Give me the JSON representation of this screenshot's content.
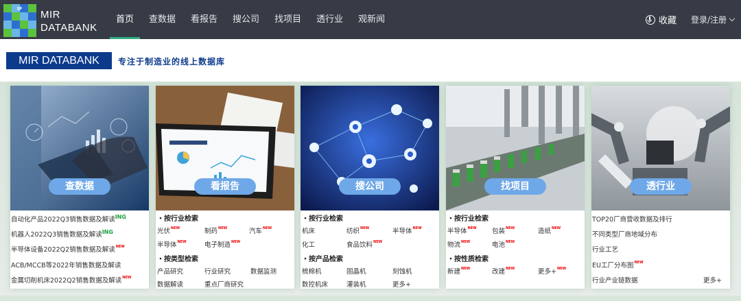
{
  "nav": {
    "brand_line1": "MIR",
    "brand_line2": "DATABANK",
    "logo_text": "IF",
    "menu": [
      "首页",
      "查数据",
      "看报告",
      "搜公司",
      "找项目",
      "透行业",
      "观新闻"
    ],
    "active_index": 0,
    "favorites_label": "收藏",
    "login_label": "登录/注册"
  },
  "colors": {
    "nav_bg": "#373b45",
    "accent_green": "#2fae7f",
    "brand_blue": "#0d3b8c",
    "pill_blue": "#6fa8e8",
    "new_red": "#e00000"
  },
  "banner": {
    "tag": "MIR DATABANK",
    "tagline": "专注于制造业的线上数据库"
  },
  "cards": [
    {
      "button": "查数据",
      "image_icon": "data-dashboard-illustration",
      "lines": [
        {
          "text": "自动化产品2022Q3销售数据及解读",
          "badge": "ING"
        },
        {
          "text": "机器人2022Q3销售数据及解读",
          "badge": "ING"
        },
        {
          "text": "半导体设备2022Q2销售数据及解读",
          "badge": "NEW"
        },
        {
          "text": "ACB/MCCB等2022年销售数据及解读",
          "badge": ""
        },
        {
          "text": "金属切削机床2022Q2销售数据及解读",
          "badge": "NEW"
        }
      ]
    },
    {
      "button": "看报告",
      "image_icon": "tablet-report-illustration",
      "sections": [
        {
          "title": "按行业检索",
          "items": [
            {
              "text": "光伏",
              "badge": "NEW"
            },
            {
              "text": "制药",
              "badge": "NEW"
            },
            {
              "text": "汽车",
              "badge": "NEW"
            },
            {
              "text": "半导体",
              "badge": "NEW"
            },
            {
              "text": "电子制造",
              "badge": "NEW"
            }
          ]
        },
        {
          "title": "按类型检索",
          "items": [
            {
              "text": "产品研究",
              "badge": ""
            },
            {
              "text": "行业研究",
              "badge": ""
            },
            {
              "text": "数据监测",
              "badge": ""
            },
            {
              "text": "数据解读",
              "badge": ""
            },
            {
              "text": "重点厂商研究",
              "badge": ""
            }
          ]
        }
      ]
    },
    {
      "button": "搜公司",
      "image_icon": "network-nodes-illustration",
      "sections": [
        {
          "title": "按行业检索",
          "items": [
            {
              "text": "机床",
              "badge": ""
            },
            {
              "text": "纺织",
              "badge": "NEW"
            },
            {
              "text": "半导体",
              "badge": "NEW"
            },
            {
              "text": "化工",
              "badge": ""
            },
            {
              "text": "食品饮料",
              "badge": "NEW"
            }
          ]
        },
        {
          "title": "按产品检索",
          "items": [
            {
              "text": "梳棉机",
              "badge": ""
            },
            {
              "text": "固晶机",
              "badge": ""
            },
            {
              "text": "刻蚀机",
              "badge": ""
            },
            {
              "text": "数控机床",
              "badge": ""
            },
            {
              "text": "灌装机",
              "badge": ""
            },
            {
              "text": "更多+",
              "badge": ""
            }
          ]
        }
      ]
    },
    {
      "button": "找项目",
      "image_icon": "production-line-illustration",
      "sections": [
        {
          "title": "按行业检索",
          "items": [
            {
              "text": "半导体",
              "badge": "NEW"
            },
            {
              "text": "包装",
              "badge": "NEW"
            },
            {
              "text": "造纸",
              "badge": "NEW"
            },
            {
              "text": "物流",
              "badge": "NEW"
            },
            {
              "text": "电池",
              "badge": "NEW"
            }
          ]
        },
        {
          "title": "按性质检索",
          "items": [
            {
              "text": "新建",
              "badge": "NEW"
            },
            {
              "text": "改建",
              "badge": "NEW"
            },
            {
              "text": "更多+",
              "badge": "NEW"
            }
          ]
        }
      ]
    },
    {
      "button": "透行业",
      "image_icon": "robot-arms-illustration",
      "lines": [
        {
          "text": "TOP20厂商营收数据及排行",
          "badge": ""
        },
        {
          "text": "不同类型厂商地域分布",
          "badge": ""
        },
        {
          "text": "行业工艺",
          "badge": ""
        },
        {
          "text": "EU工厂分布图",
          "badge": "NEW"
        },
        {
          "text": "行业产业链数据",
          "badge": ""
        }
      ],
      "more": "更多+"
    }
  ]
}
